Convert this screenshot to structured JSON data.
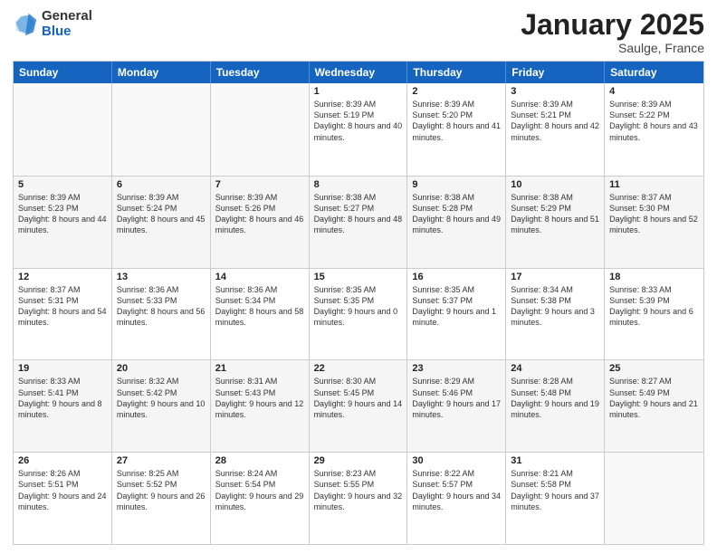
{
  "logo": {
    "general": "General",
    "blue": "Blue"
  },
  "title": "January 2025",
  "subtitle": "Saulge, France",
  "header_days": [
    "Sunday",
    "Monday",
    "Tuesday",
    "Wednesday",
    "Thursday",
    "Friday",
    "Saturday"
  ],
  "weeks": [
    [
      {
        "day": "",
        "sunrise": "",
        "sunset": "",
        "daylight": "",
        "empty": true
      },
      {
        "day": "",
        "sunrise": "",
        "sunset": "",
        "daylight": "",
        "empty": true
      },
      {
        "day": "",
        "sunrise": "",
        "sunset": "",
        "daylight": "",
        "empty": true
      },
      {
        "day": "1",
        "sunrise": "Sunrise: 8:39 AM",
        "sunset": "Sunset: 5:19 PM",
        "daylight": "Daylight: 8 hours and 40 minutes."
      },
      {
        "day": "2",
        "sunrise": "Sunrise: 8:39 AM",
        "sunset": "Sunset: 5:20 PM",
        "daylight": "Daylight: 8 hours and 41 minutes."
      },
      {
        "day": "3",
        "sunrise": "Sunrise: 8:39 AM",
        "sunset": "Sunset: 5:21 PM",
        "daylight": "Daylight: 8 hours and 42 minutes."
      },
      {
        "day": "4",
        "sunrise": "Sunrise: 8:39 AM",
        "sunset": "Sunset: 5:22 PM",
        "daylight": "Daylight: 8 hours and 43 minutes."
      }
    ],
    [
      {
        "day": "5",
        "sunrise": "Sunrise: 8:39 AM",
        "sunset": "Sunset: 5:23 PM",
        "daylight": "Daylight: 8 hours and 44 minutes."
      },
      {
        "day": "6",
        "sunrise": "Sunrise: 8:39 AM",
        "sunset": "Sunset: 5:24 PM",
        "daylight": "Daylight: 8 hours and 45 minutes."
      },
      {
        "day": "7",
        "sunrise": "Sunrise: 8:39 AM",
        "sunset": "Sunset: 5:26 PM",
        "daylight": "Daylight: 8 hours and 46 minutes."
      },
      {
        "day": "8",
        "sunrise": "Sunrise: 8:38 AM",
        "sunset": "Sunset: 5:27 PM",
        "daylight": "Daylight: 8 hours and 48 minutes."
      },
      {
        "day": "9",
        "sunrise": "Sunrise: 8:38 AM",
        "sunset": "Sunset: 5:28 PM",
        "daylight": "Daylight: 8 hours and 49 minutes."
      },
      {
        "day": "10",
        "sunrise": "Sunrise: 8:38 AM",
        "sunset": "Sunset: 5:29 PM",
        "daylight": "Daylight: 8 hours and 51 minutes."
      },
      {
        "day": "11",
        "sunrise": "Sunrise: 8:37 AM",
        "sunset": "Sunset: 5:30 PM",
        "daylight": "Daylight: 8 hours and 52 minutes."
      }
    ],
    [
      {
        "day": "12",
        "sunrise": "Sunrise: 8:37 AM",
        "sunset": "Sunset: 5:31 PM",
        "daylight": "Daylight: 8 hours and 54 minutes."
      },
      {
        "day": "13",
        "sunrise": "Sunrise: 8:36 AM",
        "sunset": "Sunset: 5:33 PM",
        "daylight": "Daylight: 8 hours and 56 minutes."
      },
      {
        "day": "14",
        "sunrise": "Sunrise: 8:36 AM",
        "sunset": "Sunset: 5:34 PM",
        "daylight": "Daylight: 8 hours and 58 minutes."
      },
      {
        "day": "15",
        "sunrise": "Sunrise: 8:35 AM",
        "sunset": "Sunset: 5:35 PM",
        "daylight": "Daylight: 9 hours and 0 minutes."
      },
      {
        "day": "16",
        "sunrise": "Sunrise: 8:35 AM",
        "sunset": "Sunset: 5:37 PM",
        "daylight": "Daylight: 9 hours and 1 minute."
      },
      {
        "day": "17",
        "sunrise": "Sunrise: 8:34 AM",
        "sunset": "Sunset: 5:38 PM",
        "daylight": "Daylight: 9 hours and 3 minutes."
      },
      {
        "day": "18",
        "sunrise": "Sunrise: 8:33 AM",
        "sunset": "Sunset: 5:39 PM",
        "daylight": "Daylight: 9 hours and 6 minutes."
      }
    ],
    [
      {
        "day": "19",
        "sunrise": "Sunrise: 8:33 AM",
        "sunset": "Sunset: 5:41 PM",
        "daylight": "Daylight: 9 hours and 8 minutes."
      },
      {
        "day": "20",
        "sunrise": "Sunrise: 8:32 AM",
        "sunset": "Sunset: 5:42 PM",
        "daylight": "Daylight: 9 hours and 10 minutes."
      },
      {
        "day": "21",
        "sunrise": "Sunrise: 8:31 AM",
        "sunset": "Sunset: 5:43 PM",
        "daylight": "Daylight: 9 hours and 12 minutes."
      },
      {
        "day": "22",
        "sunrise": "Sunrise: 8:30 AM",
        "sunset": "Sunset: 5:45 PM",
        "daylight": "Daylight: 9 hours and 14 minutes."
      },
      {
        "day": "23",
        "sunrise": "Sunrise: 8:29 AM",
        "sunset": "Sunset: 5:46 PM",
        "daylight": "Daylight: 9 hours and 17 minutes."
      },
      {
        "day": "24",
        "sunrise": "Sunrise: 8:28 AM",
        "sunset": "Sunset: 5:48 PM",
        "daylight": "Daylight: 9 hours and 19 minutes."
      },
      {
        "day": "25",
        "sunrise": "Sunrise: 8:27 AM",
        "sunset": "Sunset: 5:49 PM",
        "daylight": "Daylight: 9 hours and 21 minutes."
      }
    ],
    [
      {
        "day": "26",
        "sunrise": "Sunrise: 8:26 AM",
        "sunset": "Sunset: 5:51 PM",
        "daylight": "Daylight: 9 hours and 24 minutes."
      },
      {
        "day": "27",
        "sunrise": "Sunrise: 8:25 AM",
        "sunset": "Sunset: 5:52 PM",
        "daylight": "Daylight: 9 hours and 26 minutes."
      },
      {
        "day": "28",
        "sunrise": "Sunrise: 8:24 AM",
        "sunset": "Sunset: 5:54 PM",
        "daylight": "Daylight: 9 hours and 29 minutes."
      },
      {
        "day": "29",
        "sunrise": "Sunrise: 8:23 AM",
        "sunset": "Sunset: 5:55 PM",
        "daylight": "Daylight: 9 hours and 32 minutes."
      },
      {
        "day": "30",
        "sunrise": "Sunrise: 8:22 AM",
        "sunset": "Sunset: 5:57 PM",
        "daylight": "Daylight: 9 hours and 34 minutes."
      },
      {
        "day": "31",
        "sunrise": "Sunrise: 8:21 AM",
        "sunset": "Sunset: 5:58 PM",
        "daylight": "Daylight: 9 hours and 37 minutes."
      },
      {
        "day": "",
        "sunrise": "",
        "sunset": "",
        "daylight": "",
        "empty": true
      }
    ]
  ]
}
